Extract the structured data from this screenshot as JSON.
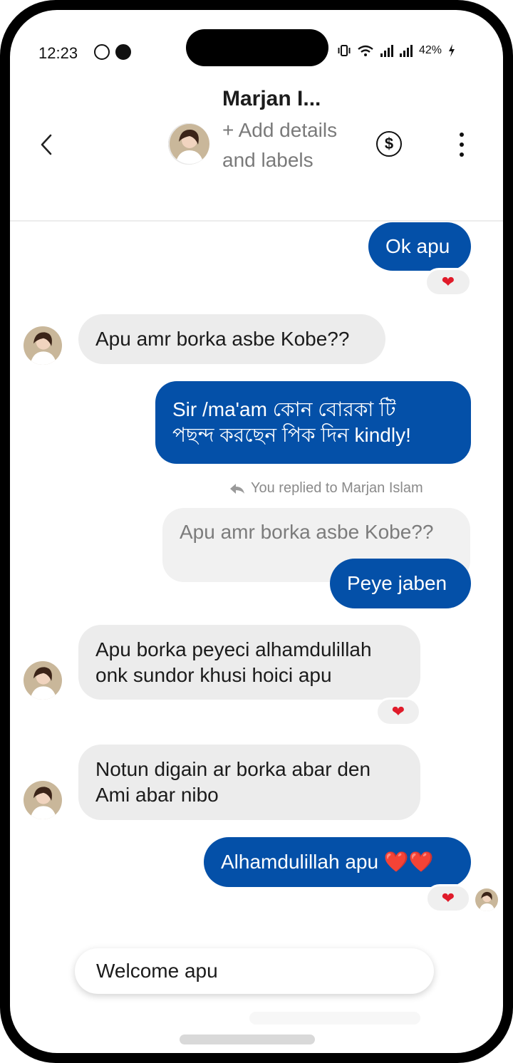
{
  "status_bar": {
    "time": "12:23",
    "battery": "42%"
  },
  "header": {
    "name": "Marjan I...",
    "subtitle": "+ Add details and labels",
    "dollar_symbol": "$"
  },
  "messages": {
    "m1": "Ok apu",
    "m2": "Apu amr borka asbe Kobe??",
    "m3_line1": "Sir /ma'am কোন বোরকা টি",
    "m3_line2": "পছন্দ করছেন পিক দিন kindly!",
    "reply_label": "You replied to Marjan Islam",
    "quoted": "Apu amr borka asbe Kobe??",
    "m4": "Peye jaben",
    "m5_line1": "Apu borka peyeci alhamdulillah",
    "m5_line2": "onk sundor khusi hoici apu",
    "m6_line1": "Notun digain ar borka abar den",
    "m6_line2": "Ami abar nibo",
    "m7": "Alhamdulillah apu ❤️❤️"
  },
  "reactions": {
    "heart": "❤"
  },
  "quick_reply": {
    "text": "Welcome apu"
  },
  "colors": {
    "outgoing": "#0450a8",
    "incoming": "#ececec",
    "heart": "#e01b2a"
  }
}
